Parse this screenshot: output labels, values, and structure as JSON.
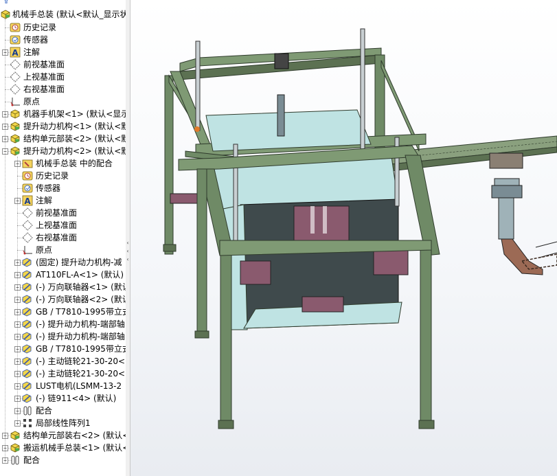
{
  "tree": {
    "top_item": "机械手总装 (默认<默认_显示状",
    "items": [
      {
        "label": "历史记录",
        "icon": "history-icon",
        "level": 1,
        "expander": ""
      },
      {
        "label": "传感器",
        "icon": "sensor-icon",
        "level": 1,
        "expander": ""
      },
      {
        "label": "注解",
        "icon": "annotation-icon",
        "level": 1,
        "expander": "+"
      },
      {
        "label": "前视基准面",
        "icon": "plane-icon",
        "level": 1,
        "expander": ""
      },
      {
        "label": "上视基准面",
        "icon": "plane-icon",
        "level": 1,
        "expander": ""
      },
      {
        "label": "右视基准面",
        "icon": "plane-icon",
        "level": 1,
        "expander": ""
      },
      {
        "label": "原点",
        "icon": "origin-icon",
        "level": 1,
        "expander": ""
      },
      {
        "label": "机器手机架<1> (默认<显示",
        "icon": "part-icon",
        "level": 1,
        "expander": "+"
      },
      {
        "label": "提升动力机构<1> (默认<默",
        "icon": "assembly-icon",
        "level": 1,
        "expander": "+"
      },
      {
        "label": "结构单元部装<2> (默认<默",
        "icon": "assembly-icon",
        "level": 1,
        "expander": "+"
      },
      {
        "label": "提升动力机构<2> (默认<默",
        "icon": "assembly-icon",
        "level": 1,
        "expander": "−"
      },
      {
        "label": "机械手总装 中的配合",
        "icon": "mates-folder-icon",
        "level": 2,
        "expander": "+"
      },
      {
        "label": "历史记录",
        "icon": "history-icon",
        "level": 2,
        "expander": ""
      },
      {
        "label": "传感器",
        "icon": "sensor-icon",
        "level": 2,
        "expander": ""
      },
      {
        "label": "注解",
        "icon": "annotation-icon",
        "level": 2,
        "expander": "+"
      },
      {
        "label": "前视基准面",
        "icon": "plane-icon",
        "level": 2,
        "expander": ""
      },
      {
        "label": "上视基准面",
        "icon": "plane-icon",
        "level": 2,
        "expander": ""
      },
      {
        "label": "右视基准面",
        "icon": "plane-icon",
        "level": 2,
        "expander": ""
      },
      {
        "label": "原点",
        "icon": "origin-icon",
        "level": 2,
        "expander": ""
      },
      {
        "label": "(固定) 提升动力机构-减",
        "icon": "subpart-icon",
        "level": 2,
        "expander": "+"
      },
      {
        "label": "AT110FL-A<1> (默认)",
        "icon": "subpart-icon",
        "level": 2,
        "expander": "+"
      },
      {
        "label": "(-) 万向联轴器<1> (默认",
        "icon": "subpart-icon",
        "level": 2,
        "expander": "+"
      },
      {
        "label": "(-) 万向联轴器<2> (默认",
        "icon": "subpart-icon",
        "level": 2,
        "expander": "+"
      },
      {
        "label": "GB / T7810-1995带立式",
        "icon": "subpart-icon",
        "level": 2,
        "expander": "+"
      },
      {
        "label": "(-) 提升动力机构-端部轴",
        "icon": "subpart-icon",
        "level": 2,
        "expander": "+"
      },
      {
        "label": "(-) 提升动力机构-端部轴",
        "icon": "subpart-icon",
        "level": 2,
        "expander": "+"
      },
      {
        "label": "GB / T7810-1995带立式",
        "icon": "subpart-icon",
        "level": 2,
        "expander": "+"
      },
      {
        "label": "(-) 主动链轮21-30-20<",
        "icon": "subpart-icon",
        "level": 2,
        "expander": "+"
      },
      {
        "label": "(-) 主动链轮21-30-20<",
        "icon": "subpart-icon",
        "level": 2,
        "expander": "+"
      },
      {
        "label": "LUST电机(LSMM-13-2",
        "icon": "subpart-icon",
        "level": 2,
        "expander": "+"
      },
      {
        "label": "(-) 链911<4> (默认)",
        "icon": "subpart-icon",
        "level": 2,
        "expander": "+"
      },
      {
        "label": "配合",
        "icon": "mates-icon",
        "level": 2,
        "expander": "+"
      },
      {
        "label": "局部线性阵列1",
        "icon": "pattern-icon",
        "level": 2,
        "expander": "+"
      },
      {
        "label": "结构单元部装右<2> (默认<",
        "icon": "assembly-icon",
        "level": 1,
        "expander": "+"
      },
      {
        "label": "搬运机械手总装<1> (默认<",
        "icon": "assembly-icon",
        "level": 1,
        "expander": "+"
      },
      {
        "label": "配合",
        "icon": "mates-icon",
        "level": 1,
        "expander": "+"
      }
    ]
  },
  "colors": {
    "frame_green": "#6f8a66",
    "frame_dark": "#2f3b2c",
    "glass": "#bfe3e3",
    "plate_purple": "#8a5a6e",
    "steel": "#7a8c94",
    "brown": "#9c6a55"
  },
  "splitter": {
    "grip_icon": "collapse-arrows-icon"
  }
}
